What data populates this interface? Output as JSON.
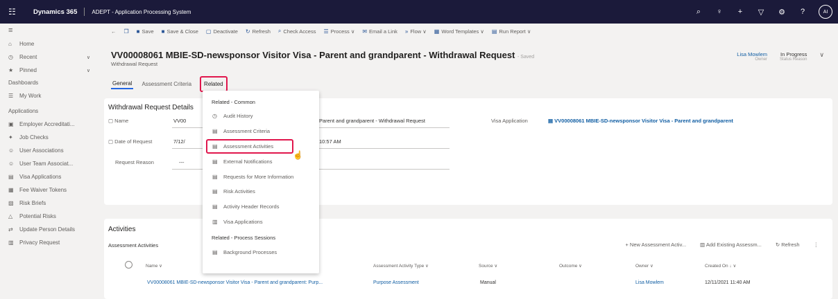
{
  "topbar": {
    "waffle": "☷",
    "brand": "Dynamics 365",
    "app_name": "ADEPT - Application Processing System",
    "icons": [
      "⌕",
      "♀",
      "+",
      "▽",
      "⚙",
      "?"
    ],
    "avatar": "AI"
  },
  "sidebar": {
    "menu": "≡",
    "top_items": [
      {
        "icon": "⌂",
        "label": "Home"
      },
      {
        "icon": "◷",
        "label": "Recent",
        "chevron": "∨"
      },
      {
        "icon": "★",
        "label": "Pinned",
        "chevron": "∨"
      }
    ],
    "dashboards_header": "Dashboards",
    "dashboards": [
      {
        "icon": "☰",
        "label": "My Work"
      }
    ],
    "applications_header": "Applications",
    "applications": [
      {
        "icon": "▣",
        "label": "Employer Accreditati..."
      },
      {
        "icon": "✦",
        "label": "Job Checks"
      },
      {
        "icon": "☺",
        "label": "User Associations"
      },
      {
        "icon": "☺",
        "label": "User Team Associat..."
      },
      {
        "icon": "▤",
        "label": "Visa Applications"
      },
      {
        "icon": "▦",
        "label": "Fee Waiver Tokens"
      },
      {
        "icon": "▧",
        "label": "Risk Briefs"
      },
      {
        "icon": "△",
        "label": "Potential Risks"
      },
      {
        "icon": "⇄",
        "label": "Update Person Details"
      },
      {
        "icon": "▥",
        "label": "Privacy Request"
      }
    ]
  },
  "cmdbar": {
    "back": "←",
    "items": [
      {
        "icon": "❐",
        "label": ""
      },
      {
        "icon": "■",
        "label": "Save"
      },
      {
        "icon": "■",
        "label": "Save & Close"
      },
      {
        "icon": "▢",
        "label": "Deactivate"
      },
      {
        "icon": "↻",
        "label": "Refresh"
      },
      {
        "icon": "⌕",
        "label": "Check Access"
      },
      {
        "icon": "☰",
        "label": "Process ∨"
      },
      {
        "icon": "✉",
        "label": "Email a Link"
      },
      {
        "icon": "»",
        "label": "Flow ∨"
      },
      {
        "icon": "▦",
        "label": "Word Templates ∨"
      },
      {
        "icon": "▤",
        "label": "Run Report ∨"
      }
    ]
  },
  "header": {
    "title": "VV00008061 MBIE-SD-newsponsor Visitor Visa - Parent and grandparent - Withdrawal Request",
    "saved": "- Saved",
    "subtitle": "Withdrawal Request",
    "owner_value": "Lisa Mowlem",
    "owner_label": "Owner",
    "status_value": "In Progress",
    "status_label": "Status Reason",
    "expand": "∨"
  },
  "tabs": [
    "General",
    "Assessment Criteria",
    "Related"
  ],
  "details": {
    "title": "Withdrawal Request Details",
    "name_label": "Name",
    "name_value_prefix": "VV00",
    "name_value_suffix": "Parent and grandparent - Withdrawal Request",
    "date_label": "Date of Request",
    "date_value_prefix": "7/12/",
    "date_time": "10:57 AM",
    "reason_label": "Request Reason",
    "reason_value": "---",
    "visa_label": "Visa Application",
    "visa_value": "VV00008061 MBIE-SD-newsponsor Visitor Visa - Parent and grandparent"
  },
  "dropdown": {
    "section1": "Related - Common",
    "items1": [
      {
        "icon": "◷",
        "label": "Audit History"
      },
      {
        "icon": "▤",
        "label": "Assessment Criteria"
      },
      {
        "icon": "▤",
        "label": "Assessment Activities"
      },
      {
        "icon": "▤",
        "label": "External Notifications"
      },
      {
        "icon": "▤",
        "label": "Requests for More Information"
      },
      {
        "icon": "▤",
        "label": "Risk Activities"
      },
      {
        "icon": "▤",
        "label": "Activity Header Records"
      },
      {
        "icon": "▥",
        "label": "Visa Applications"
      }
    ],
    "section2": "Related - Process Sessions",
    "items2": [
      {
        "icon": "▤",
        "label": "Background Processes"
      }
    ]
  },
  "activities": {
    "title": "Activities",
    "subtitle": "Assessment Activities",
    "new_label": "+ New Assessment Activ...",
    "existing_label": "Add Existing Assessm...",
    "refresh_label": "↻ Refresh",
    "more": "⋮",
    "columns": [
      "Name ∨",
      "Assessment Activity Type ∨",
      "Source ∨",
      "Outcome ∨",
      "Owner ∨",
      "Created On ↓ ∨"
    ],
    "row": {
      "name": "VV00008061 MBIE-SD-newsponsor Visitor Visa - Parent and grandparent: Purp...",
      "type": "Purpose Assessment",
      "source": "Manual",
      "outcome": "",
      "owner": "Lisa Mowlem",
      "created": "12/11/2021 11:40 AM"
    }
  },
  "cursor": "☝"
}
